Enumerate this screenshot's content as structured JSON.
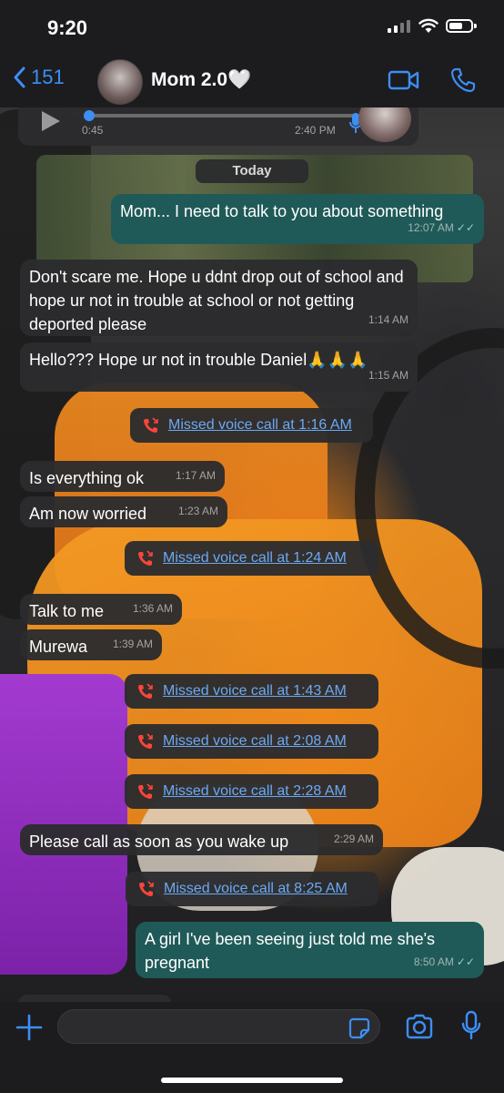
{
  "status_bar": {
    "time": "9:20"
  },
  "header": {
    "back_count": "151",
    "contact_name": "Mom 2.0🤍"
  },
  "voice_note": {
    "duration": "0:45",
    "time": "2:40 PM"
  },
  "date_separator": "Today",
  "messages": [
    {
      "dir": "out",
      "text": "Mom... I need to talk to you about something",
      "time": "12:07 AM",
      "read": true
    },
    {
      "dir": "in",
      "text": "Don't scare me. Hope u ddnt drop out of school and hope ur not in trouble at school or not getting deported please",
      "time": "1:14 AM"
    },
    {
      "dir": "in",
      "text": "Hello??? Hope ur not in trouble Daniel🙏🙏🙏",
      "time": "1:15 AM"
    },
    {
      "dir": "sys",
      "text": "Missed voice call at 1:16 AM"
    },
    {
      "dir": "in",
      "text": "Is everything ok",
      "time": "1:17 AM"
    },
    {
      "dir": "in",
      "text": "Am now worried",
      "time": "1:23 AM"
    },
    {
      "dir": "sys",
      "text": "Missed voice call at 1:24 AM"
    },
    {
      "dir": "in",
      "text": "Talk to me",
      "time": "1:36 AM"
    },
    {
      "dir": "in",
      "text": "Murewa",
      "time": "1:39 AM"
    },
    {
      "dir": "sys",
      "text": "Missed voice call at 1:43 AM"
    },
    {
      "dir": "sys",
      "text": "Missed voice call at 2:08 AM"
    },
    {
      "dir": "sys",
      "text": "Missed voice call at 2:28 AM"
    },
    {
      "dir": "in",
      "text": "Please call as soon as you wake up",
      "time": "2:29 AM"
    },
    {
      "dir": "sys",
      "text": "Missed voice call at 8:25 AM"
    },
    {
      "dir": "out",
      "text": "A girl I've been seeing just told me she's pregnant",
      "time": "8:50 AM",
      "read": true
    }
  ],
  "input": {
    "placeholder": ""
  },
  "colors": {
    "accent": "#3d8ef5",
    "outgoing_bubble": "#1f5a58",
    "incoming_bubble": "#2c2c2e",
    "missed_call_icon": "#ff453a"
  }
}
